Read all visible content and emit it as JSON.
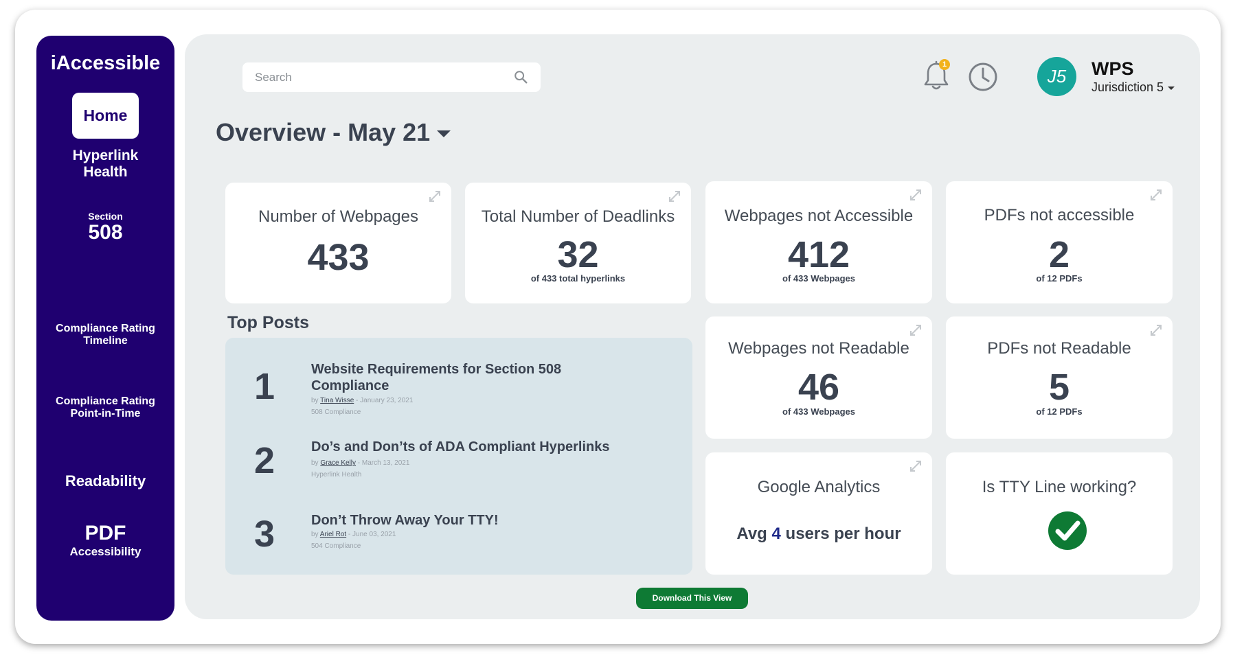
{
  "sidebar": {
    "brand": "iAccessible",
    "home": "Home",
    "items": [
      {
        "line1": "Hyperlink",
        "line2": "Health"
      },
      {
        "line1": "Section",
        "line2": "508"
      },
      {
        "line1": "Compliance Rating",
        "line2": "Timeline"
      },
      {
        "line1": "Compliance Rating",
        "line2": "Point-in-Time"
      },
      {
        "line1": "Readability",
        "line2": ""
      },
      {
        "line1": "PDF",
        "line2": "Accessibility"
      }
    ]
  },
  "header": {
    "search_placeholder": "Search",
    "notification_count": "1",
    "avatar_initials": "J5",
    "org_name": "WPS",
    "jurisdiction": "Jurisdiction 5",
    "overview": "Overview - May 21"
  },
  "cards": {
    "webpages": {
      "title": "Number of Webpages",
      "value": "433"
    },
    "deadlinks": {
      "title": "Total Number of Deadlinks",
      "value": "32",
      "sub": "of 433 total hyperlinks"
    },
    "not_accessible": {
      "title": "Webpages not Accessible",
      "value": "412",
      "sub": "of 433 Webpages"
    },
    "pdfs_not_accessible": {
      "title": "PDFs not accessible",
      "value": "2",
      "sub": "of 12 PDFs"
    },
    "not_readable": {
      "title": "Webpages not Readable",
      "value": "46",
      "sub": "of 433 Webpages"
    },
    "pdfs_not_readable": {
      "title": "PDFs not Readable",
      "value": "5",
      "sub": "of 12 PDFs"
    },
    "analytics": {
      "title": "Google Analytics",
      "prefix": "Avg ",
      "number": "4",
      "suffix": " users per hour"
    },
    "tty": {
      "title": "Is TTY Line working?"
    }
  },
  "top_posts": {
    "title": "Top Posts",
    "posts": [
      {
        "rank": "1",
        "title": "Website Requirements for Section 508 Compliance",
        "by": "by ",
        "author": "Tina Wisse",
        "date": " - January 23, 2021",
        "category": "508 Compliance"
      },
      {
        "rank": "2",
        "title": "Do’s and Don’ts of ADA Compliant Hyperlinks",
        "by": "by ",
        "author": "Grace Kelly",
        "date": " - March 13, 2021",
        "category": "Hyperlink Health"
      },
      {
        "rank": "3",
        "title": "Don’t Throw Away Your TTY!",
        "by": "by ",
        "author": "Ariel Rot",
        "date": " - June 03, 2021",
        "category": "504 Compliance"
      }
    ]
  },
  "download_label": "Download This View",
  "colors": {
    "sidebar": "#1f0070",
    "accent_green": "#0e7a34",
    "avatar": "#16a59a",
    "tty_status": "#0e7a34"
  }
}
